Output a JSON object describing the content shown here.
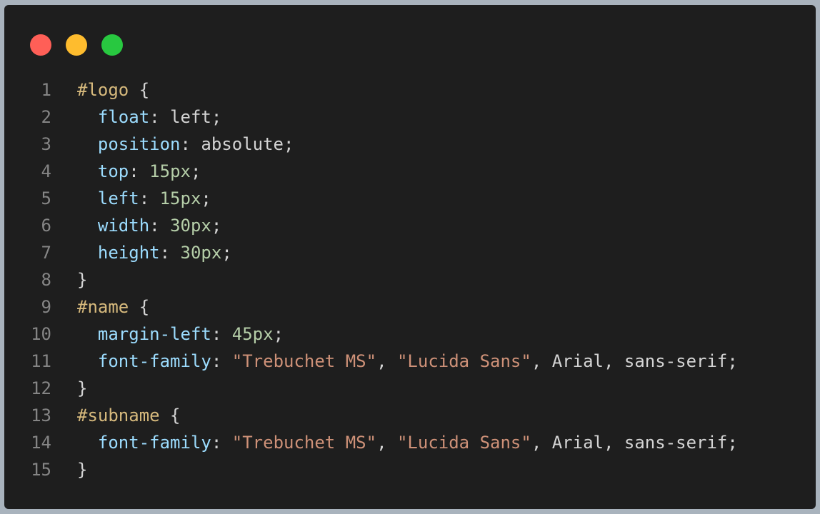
{
  "window": {
    "buttons": [
      {
        "name": "close",
        "color": "#ff5f57"
      },
      {
        "name": "minimize",
        "color": "#febc2e"
      },
      {
        "name": "maximize",
        "color": "#28c840"
      }
    ]
  },
  "colors": {
    "selector": "#d7ba7d",
    "property": "#9cdcfe",
    "number": "#b5cea8",
    "string": "#ce9178",
    "value": "#d4d4d4",
    "line_number": "#858585",
    "background": "#1e1e1e"
  },
  "code": {
    "language": "css",
    "lines": [
      {
        "n": "1",
        "tokens": [
          {
            "t": "#logo",
            "k": "selector"
          },
          {
            "t": " {",
            "k": "punct"
          }
        ]
      },
      {
        "n": "2",
        "tokens": [
          {
            "t": "  ",
            "k": "punct"
          },
          {
            "t": "float",
            "k": "prop"
          },
          {
            "t": ": ",
            "k": "punct"
          },
          {
            "t": "left",
            "k": "value"
          },
          {
            "t": ";",
            "k": "punct"
          }
        ]
      },
      {
        "n": "3",
        "tokens": [
          {
            "t": "  ",
            "k": "punct"
          },
          {
            "t": "position",
            "k": "prop"
          },
          {
            "t": ": ",
            "k": "punct"
          },
          {
            "t": "absolute",
            "k": "value"
          },
          {
            "t": ";",
            "k": "punct"
          }
        ]
      },
      {
        "n": "4",
        "tokens": [
          {
            "t": "  ",
            "k": "punct"
          },
          {
            "t": "top",
            "k": "prop"
          },
          {
            "t": ": ",
            "k": "punct"
          },
          {
            "t": "15px",
            "k": "number"
          },
          {
            "t": ";",
            "k": "punct"
          }
        ]
      },
      {
        "n": "5",
        "tokens": [
          {
            "t": "  ",
            "k": "punct"
          },
          {
            "t": "left",
            "k": "prop"
          },
          {
            "t": ": ",
            "k": "punct"
          },
          {
            "t": "15px",
            "k": "number"
          },
          {
            "t": ";",
            "k": "punct"
          }
        ]
      },
      {
        "n": "6",
        "tokens": [
          {
            "t": "  ",
            "k": "punct"
          },
          {
            "t": "width",
            "k": "prop"
          },
          {
            "t": ": ",
            "k": "punct"
          },
          {
            "t": "30px",
            "k": "number"
          },
          {
            "t": ";",
            "k": "punct"
          }
        ]
      },
      {
        "n": "7",
        "tokens": [
          {
            "t": "  ",
            "k": "punct"
          },
          {
            "t": "height",
            "k": "prop"
          },
          {
            "t": ": ",
            "k": "punct"
          },
          {
            "t": "30px",
            "k": "number"
          },
          {
            "t": ";",
            "k": "punct"
          }
        ]
      },
      {
        "n": "8",
        "tokens": [
          {
            "t": "}",
            "k": "punct"
          }
        ]
      },
      {
        "n": "9",
        "tokens": [
          {
            "t": "#name",
            "k": "selector"
          },
          {
            "t": " {",
            "k": "punct"
          }
        ]
      },
      {
        "n": "10",
        "tokens": [
          {
            "t": "  ",
            "k": "punct"
          },
          {
            "t": "margin-left",
            "k": "prop"
          },
          {
            "t": ": ",
            "k": "punct"
          },
          {
            "t": "45px",
            "k": "number"
          },
          {
            "t": ";",
            "k": "punct"
          }
        ]
      },
      {
        "n": "11",
        "tokens": [
          {
            "t": "  ",
            "k": "punct"
          },
          {
            "t": "font-family",
            "k": "prop"
          },
          {
            "t": ": ",
            "k": "punct"
          },
          {
            "t": "\"Trebuchet MS\"",
            "k": "string"
          },
          {
            "t": ", ",
            "k": "punct"
          },
          {
            "t": "\"Lucida Sans\"",
            "k": "string"
          },
          {
            "t": ", ",
            "k": "punct"
          },
          {
            "t": "Arial",
            "k": "value"
          },
          {
            "t": ", ",
            "k": "punct"
          },
          {
            "t": "sans-serif",
            "k": "value"
          },
          {
            "t": ";",
            "k": "punct"
          }
        ]
      },
      {
        "n": "12",
        "tokens": [
          {
            "t": "}",
            "k": "punct"
          }
        ]
      },
      {
        "n": "13",
        "tokens": [
          {
            "t": "#subname",
            "k": "selector"
          },
          {
            "t": " {",
            "k": "punct"
          }
        ]
      },
      {
        "n": "14",
        "tokens": [
          {
            "t": "  ",
            "k": "punct"
          },
          {
            "t": "font-family",
            "k": "prop"
          },
          {
            "t": ": ",
            "k": "punct"
          },
          {
            "t": "\"Trebuchet MS\"",
            "k": "string"
          },
          {
            "t": ", ",
            "k": "punct"
          },
          {
            "t": "\"Lucida Sans\"",
            "k": "string"
          },
          {
            "t": ", ",
            "k": "punct"
          },
          {
            "t": "Arial",
            "k": "value"
          },
          {
            "t": ", ",
            "k": "punct"
          },
          {
            "t": "sans-serif",
            "k": "value"
          },
          {
            "t": ";",
            "k": "punct"
          }
        ]
      },
      {
        "n": "15",
        "tokens": [
          {
            "t": "}",
            "k": "punct"
          }
        ]
      }
    ]
  }
}
